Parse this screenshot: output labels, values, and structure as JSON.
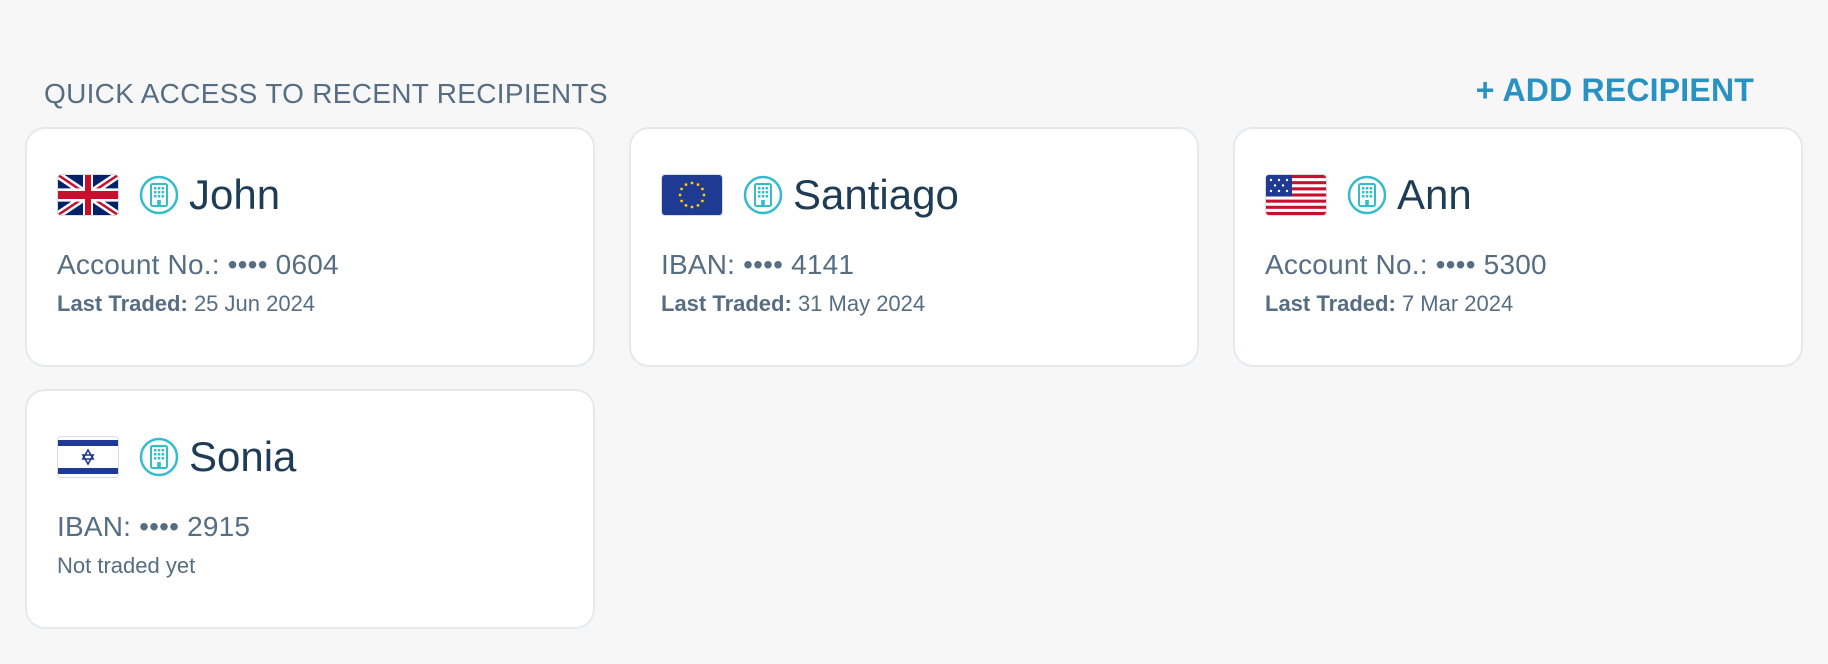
{
  "header": {
    "title": "QUICK ACCESS TO RECENT RECIPIENTS",
    "add_label": "+ ADD RECIPIENT"
  },
  "colors": {
    "accent": "#2a92c2",
    "title": "#566d82",
    "name": "#1e3c55",
    "card_border": "#e6e9ec",
    "icon_teal": "#35bccb"
  },
  "recipients": [
    {
      "name": "John",
      "flag_icon": "uk-flag-icon",
      "account_type_icon": "bank-building-icon",
      "account": "Account No.: •••• 0604",
      "trade_label": "Last Traded:",
      "trade_value": "25 Jun 2024"
    },
    {
      "name": "Santiago",
      "flag_icon": "eu-flag-icon",
      "account_type_icon": "bank-building-icon",
      "account": "IBAN: •••• 4141",
      "trade_label": "Last Traded:",
      "trade_value": "31 May 2024"
    },
    {
      "name": "Ann",
      "flag_icon": "us-flag-icon",
      "account_type_icon": "bank-building-icon",
      "account": "Account No.: •••• 5300",
      "trade_label": "Last Traded:",
      "trade_value": "7 Mar 2024"
    },
    {
      "name": "Sonia",
      "flag_icon": "israel-flag-icon",
      "account_type_icon": "bank-building-icon",
      "account": "IBAN: •••• 2915",
      "trade_label": "",
      "trade_value": "Not traded yet"
    }
  ]
}
